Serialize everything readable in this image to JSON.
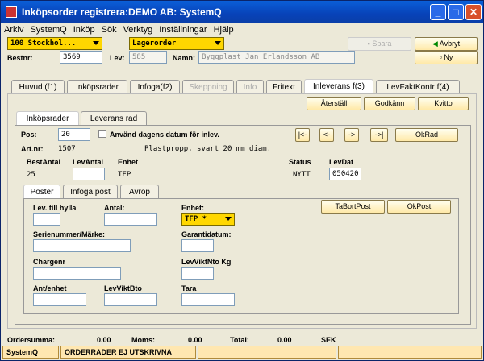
{
  "window": {
    "title": "Inköpsorder registrera:DEMO AB: SystemQ",
    "min": "_",
    "max": "□",
    "close": "✕"
  },
  "menu": [
    "Arkiv",
    "SystemQ",
    "Inköp",
    "Sök",
    "Verktyg",
    "Inställningar",
    "Hjälp"
  ],
  "header": {
    "location": "100  Stockhol...",
    "order_type": "Lagerorder",
    "spara": "Spara",
    "avbryt": "Avbryt",
    "ny": "Ny",
    "bestnr_label": "Bestnr:",
    "bestnr": "3569",
    "lev_label": "Lev:",
    "lev": "585",
    "namn_label": "Namn:",
    "namn": "Byggplast Jan Erlandsson AB"
  },
  "tabs": [
    {
      "label": "Huvud (f1)"
    },
    {
      "label": "Inköpsrader"
    },
    {
      "label": "Infoga(f2)"
    },
    {
      "label": "Skeppning"
    },
    {
      "label": "Info"
    },
    {
      "label": "Fritext"
    },
    {
      "label": "Inleverans f(3)"
    },
    {
      "label": "LevFaktKontr f(4)"
    }
  ],
  "actions": {
    "aterstall": "Återställ",
    "godkann": "Godkänn",
    "kvitto": "Kvitto"
  },
  "subtabs": [
    "Inköpsrader",
    "Leverans rad"
  ],
  "row": {
    "pos_label": "Pos:",
    "pos": "20",
    "use_date_label": "Använd dagens datum för inlev.",
    "first": "|<-",
    "prev": "<-",
    "next": "->",
    "last": "->|",
    "okrad": "OkRad",
    "artnr_label": "Art.nr:",
    "artnr": "1507",
    "desc": "Plastpropp, svart 20 mm diam.",
    "bestantal_label": "BestAntal",
    "bestantal": "25",
    "levantal_label": "LevAntal",
    "levantal": "",
    "enhet_label": "Enhet",
    "enhet": "TFP",
    "status_label": "Status",
    "status": "NYTT",
    "levdat_label": "LevDat",
    "levdat": "050420"
  },
  "innertabs": [
    "Poster",
    "Infoga post",
    "Avrop"
  ],
  "poster": {
    "lev_hylla": "Lev. till hylla",
    "antal": "Antal:",
    "enhet": "Enhet:",
    "enhet_val": "TFP *",
    "tabortpost": "TaBortPost",
    "okpost": "OkPost",
    "serienr": "Serienummer/Märke:",
    "garanti": "Garantidatum:",
    "chargenr": "Chargenr",
    "levvikt_nto": "LevViktNto Kg",
    "ant_enhet": "Ant/enhet",
    "levvikt_bto": "LevViktBto",
    "tara": "Tara"
  },
  "summary": {
    "ordersumma_label": "Ordersumma:",
    "ordersumma": "0.00",
    "moms_label": "Moms:",
    "moms": "0.00",
    "total_label": "Total:",
    "total": "0.00",
    "currency": "SEK"
  },
  "status": {
    "app": "SystemQ",
    "message": "ORDERRADER EJ UTSKRIVNA"
  }
}
